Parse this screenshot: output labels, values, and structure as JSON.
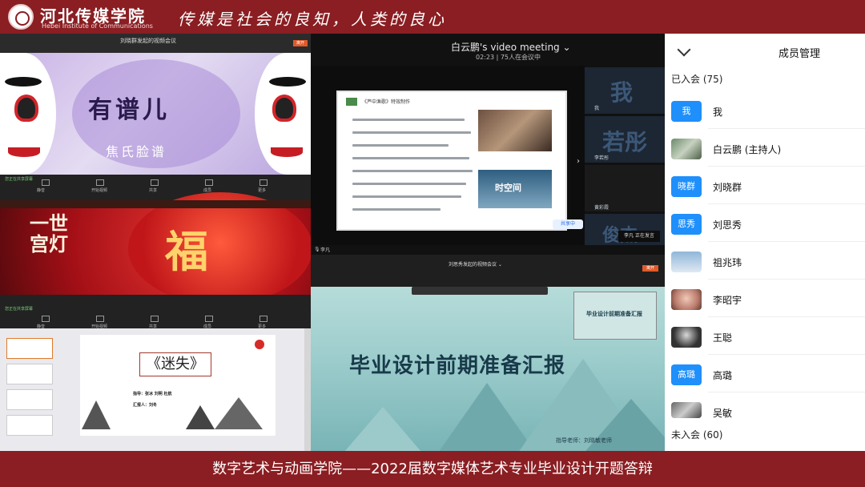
{
  "header": {
    "school_name": "河北传媒学院",
    "school_en": "Hebei Institute of Communications",
    "motto": "传媒是社会的良知，人类的良心"
  },
  "footer": {
    "caption": "数字艺术与动画学院——2022届数字媒体艺术专业毕业设计开题答辩"
  },
  "panel_top_left": {
    "meeting_title": "刘晓群发起的视频会议",
    "exit_label": "离开",
    "slide_title": "有谱儿",
    "slide_subtitle": "焦氏脸谱",
    "status_text": "您正在共享屏幕",
    "controls": [
      "静音",
      "开始视频",
      "共享",
      "成员",
      "更多"
    ]
  },
  "panel_mid_left": {
    "vertical_text": "一世宫灯",
    "char": "福"
  },
  "panel_bottom_left": {
    "slide_title": "《迷失》",
    "info_line1": "指导：张冰 刘明 杜航 ",
    "info_line2": "汇报人：刘冬",
    "status_text": "您正在共享屏幕",
    "controls": [
      "静音",
      "开始视频",
      "共享",
      "成员",
      "更多"
    ]
  },
  "panel_center_top": {
    "meeting_title": "白云鹏's video meeting ⌄",
    "time_info": "02:23 | 75人在会议中",
    "slide_heading": "《芦中渔歌》特效制作",
    "img2_text": "时空间",
    "share_label": "共享中",
    "speaker_name": "李凡",
    "talking_label": "李凡 正在发言",
    "tiles": [
      {
        "big": "我",
        "name": "我"
      },
      {
        "big": "若彤",
        "name": "李若彤"
      },
      {
        "big": "",
        "name": "黄彩霞"
      },
      {
        "big": "俊杰",
        "name": ""
      }
    ]
  },
  "panel_center_bottom": {
    "meeting_title": "刘思秀发起的视频会议 ⌄",
    "exit_label": "离开",
    "slide_heading": "毕业设计前期准备汇报",
    "pip_text": "毕业设计前期准备汇报",
    "teacher_text": "指导老师：刘晓敏老师"
  },
  "members": {
    "panel_title": "成员管理",
    "joined_label": "已入会 (75)",
    "not_joined_label": "未入会 (60)",
    "list": [
      {
        "avatar_text": "我",
        "name": "我",
        "avatar": "blue"
      },
      {
        "avatar_text": "",
        "name": "白云鹏 (主持人)",
        "avatar": "photo"
      },
      {
        "avatar_text": "晓群",
        "name": "刘晓群",
        "avatar": "blue"
      },
      {
        "avatar_text": "思秀",
        "name": "刘思秀",
        "avatar": "blue"
      },
      {
        "avatar_text": "",
        "name": "祖兆玮",
        "avatar": "photo"
      },
      {
        "avatar_text": "",
        "name": "李昭宇",
        "avatar": "photo"
      },
      {
        "avatar_text": "",
        "name": "王聪",
        "avatar": "photo"
      },
      {
        "avatar_text": "高璐",
        "name": "高璐",
        "avatar": "blue"
      },
      {
        "avatar_text": "",
        "name": "吴敏",
        "avatar": "photo"
      }
    ]
  },
  "colors": {
    "banner": "#8a1e22",
    "accent_blue": "#1f8ffb",
    "exit_orange": "#e05a2a"
  }
}
